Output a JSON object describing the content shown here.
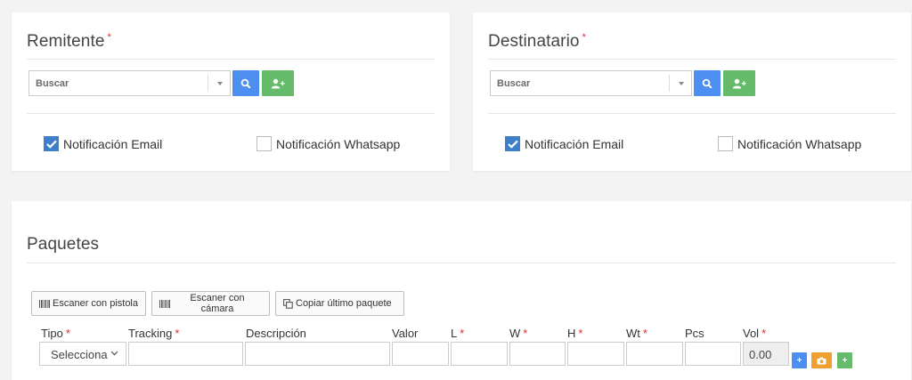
{
  "remitente": {
    "title": "Remitente",
    "required_mark": "*",
    "search_placeholder": "Buscar",
    "notify_email_label": "Notificación Email",
    "notify_email_checked": true,
    "notify_whatsapp_label": "Notificación Whatsapp",
    "notify_whatsapp_checked": false
  },
  "destinatario": {
    "title": "Destinatario",
    "required_mark": "*",
    "search_placeholder": "Buscar",
    "notify_email_label": "Notificación Email",
    "notify_email_checked": true,
    "notify_whatsapp_label": "Notificación Whatsapp",
    "notify_whatsapp_checked": false
  },
  "paquetes": {
    "title": "Paquetes",
    "buttons": {
      "scan_gun": "Escaner con pistola",
      "scan_camera": "Escaner con cámara",
      "copy_last": "Copiar último paquete"
    },
    "columns": [
      {
        "label": "Tipo",
        "required": "*"
      },
      {
        "label": "Tracking",
        "required": "*"
      },
      {
        "label": "Descripción",
        "required": ""
      },
      {
        "label": "Valor",
        "required": ""
      },
      {
        "label": "L",
        "required": "*"
      },
      {
        "label": "W",
        "required": "*"
      },
      {
        "label": "H",
        "required": "*"
      },
      {
        "label": "Wt",
        "required": "*"
      },
      {
        "label": "Pcs",
        "required": ""
      },
      {
        "label": "Vol",
        "required": "*"
      }
    ],
    "row": {
      "tipo_value": "Selecciona",
      "vol_value": "0.00"
    },
    "row_actions": {
      "add": "+",
      "add_green": "+"
    }
  },
  "colors": {
    "primary": "#4d8ff0",
    "success": "#66bb6a",
    "warning": "#f0a030",
    "checkbox": "#3d7fc9",
    "required": "#e02a2a"
  }
}
